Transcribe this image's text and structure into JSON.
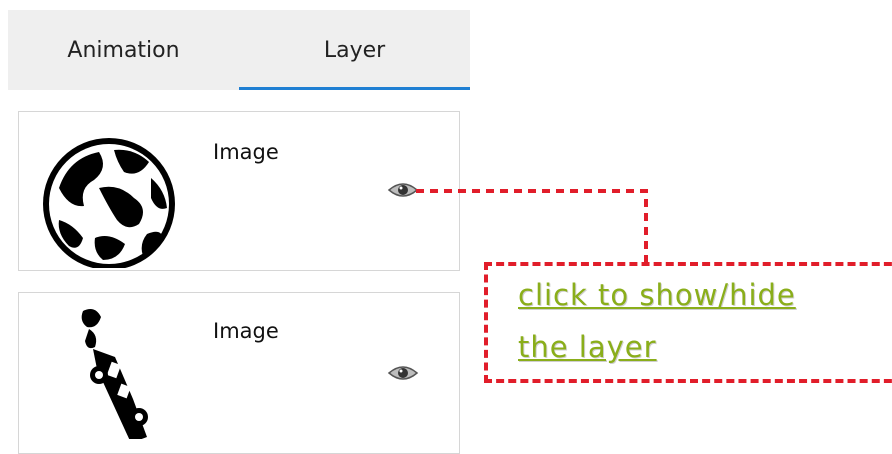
{
  "tabs": [
    {
      "label": "Animation",
      "active": false
    },
    {
      "label": "Layer",
      "active": true
    }
  ],
  "accent_color": "#1f7fd3",
  "layers": [
    {
      "name": "Image",
      "thumbnail_icon": "globe-icon",
      "visibility_icon": "eye-icon"
    },
    {
      "name": "Image",
      "thumbnail_icon": "car-icon",
      "visibility_icon": "eye-icon"
    }
  ],
  "callout": {
    "line1": "click to show/hide",
    "line2": "the layer",
    "text_color": "#8aae1a",
    "border_color": "#e11d2a"
  }
}
